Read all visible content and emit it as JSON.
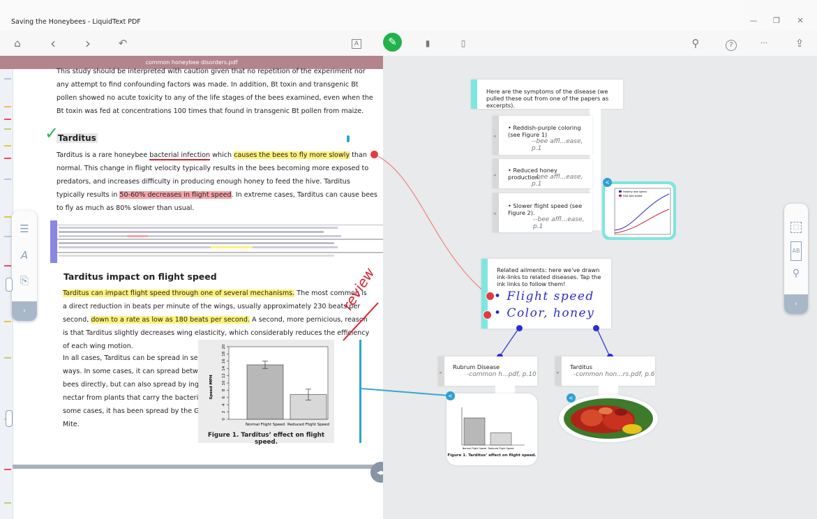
{
  "window": {
    "title": "Saving the Honeybees - LiquidText PDF",
    "controls": {
      "minimize": "—",
      "maximize": "❐",
      "close": "✕"
    }
  },
  "toolbar": {
    "home_icon": "⌂",
    "back_icon": "‹",
    "forward_icon": "›",
    "undo_icon": "↶",
    "text_tool_icon": "A",
    "pen_icon": "✎",
    "highlighter_icon": "▮",
    "eraser_icon": "▯",
    "search_icon": "⚲",
    "help_icon": "?",
    "more_icon": "···",
    "share_icon": "⇪",
    "active_color": "#22b24c"
  },
  "document": {
    "tab_title": "common honeybee disorders.pdf",
    "intro_lines": [
      "This study should be interpreted with caution given that no repetition of the experiment nor",
      "any attempt to find confounding factors was made. In addition, Bt toxin and transgenic Bt",
      "pollen showed no acute toxicity to any of the life stages of the bees examined, even when the",
      "Bt toxin was fed at concentrations 100 times that found in transgenic Bt pollen from maize."
    ],
    "heading1": "Tarditus",
    "p1": {
      "l1_a": "Tarditus is a rare honeybee ",
      "l1_u": "bacterial infection",
      "l1_b": " which ",
      "l1_hl": "causes the bees to fly more slowly",
      "l1_c": " than",
      "l2": "normal. This change in flight velocity typically results in the bees becoming more exposed to",
      "l3": "predators, and increases difficulty in producing enough honey to feed the hive. Tarditus",
      "l4_a": "typically results in ",
      "l4_hl": "50-60% decreases in flight speed",
      "l4_b": ". In extreme cases, Tarditus can cause bees",
      "l5": "to fly as much as 80% slower than usual."
    },
    "heading2": "Tarditus impact on flight speed",
    "p2": {
      "l1_hl": "Tarditus can impact flight speed through one of several mechanisms.",
      "l1_b": " The most common is",
      "l2": "a direct reduction in beats per minute of the wings, usually approximately 230 beats per",
      "l3_a": "second, ",
      "l3_hl": "down to a rate as low as 180 beats per second.",
      "l3_b": " A second, more pernicious, reason",
      "l4": "is that Tarditus slightly decreases wing elasticity, which considerably reduces the efficiency",
      "l5": "of each wing motion.",
      "l6": "In all cases, Tarditus can be spread in several",
      "l7": "ways. In some cases, it can spread between",
      "l8": "bees directly, but can also spread by ingesting",
      "l9": "nectar from plants that carry the bacteria. In",
      "l10": "some cases, it has been spread by the Grey",
      "l11": "Mite."
    },
    "review_annotation": "review",
    "checkmark": "✓",
    "highlight_yellow": "#fff27a",
    "highlight_red": "#f6a4a9"
  },
  "figure1": {
    "caption": "Figure 1. Tarditus’ effect on flight speed.",
    "chart_data": {
      "type": "bar",
      "categories": [
        "Normal Flight Speed",
        "Reduced Flight Speed"
      ],
      "values": [
        15,
        6.8
      ],
      "errors": [
        1.0,
        1.5
      ],
      "ylabel": "Speed MPH",
      "ylim": [
        0,
        20
      ],
      "yticks": [
        0,
        2,
        4,
        6,
        8,
        10,
        12,
        14,
        16,
        18,
        20
      ],
      "grid": false
    }
  },
  "left_tools": {
    "collapse_icon": "›",
    "t1": "☰",
    "t2": "A",
    "t3": "⎘"
  },
  "right_tools": {
    "t1": "⬚",
    "t2": "AB",
    "t3": "⚲",
    "collapse_icon": "‹"
  },
  "workspace": {
    "symptoms_note": {
      "header": "Here are the symptoms of the disease (we pulled these out from one of the papers as excerpts).",
      "items": [
        {
          "text": "• Reddish-purple coloring (see Figure 1)",
          "cite": "--bee affl...ease, p.1"
        },
        {
          "text": "• Reduced honey production.",
          "cite": "--bee affl...ease, p.1"
        },
        {
          "text": "• Slower flight speed (see Figure 2).",
          "cite": "--bee affl...ease, p.1"
        }
      ]
    },
    "line_chart": {
      "chart_data": {
        "type": "line",
        "series": [
          {
            "name": "Healthy bee speed",
            "color": "#2a2ed6"
          },
          {
            "name": "SAD bee speed",
            "color": "#d42030"
          }
        ],
        "xticks": [
          "0",
          "20",
          "40",
          "60",
          "80",
          "100",
          "120",
          "140",
          "160",
          "180"
        ],
        "yticks": [
          "0",
          "2",
          "4",
          "6",
          "8",
          "10",
          "12",
          "14"
        ]
      }
    },
    "related_note": {
      "text": "Related ailments: here we've drawn ink-links to related diseases. Tap the ink links to follow them!",
      "ink1": "• Flight speed",
      "ink2": "• Color, honey"
    },
    "rubrum": {
      "title": "Rubrum Disease",
      "cite": "-common h...pdf, p.10"
    },
    "tarditus": {
      "title": "Tarditus",
      "cite": "-common hon...rs.pdf, p.6"
    },
    "mini_figure_caption": "Figure 1. Tarditus’ effect on flight speed.",
    "badge_icon": "<"
  }
}
